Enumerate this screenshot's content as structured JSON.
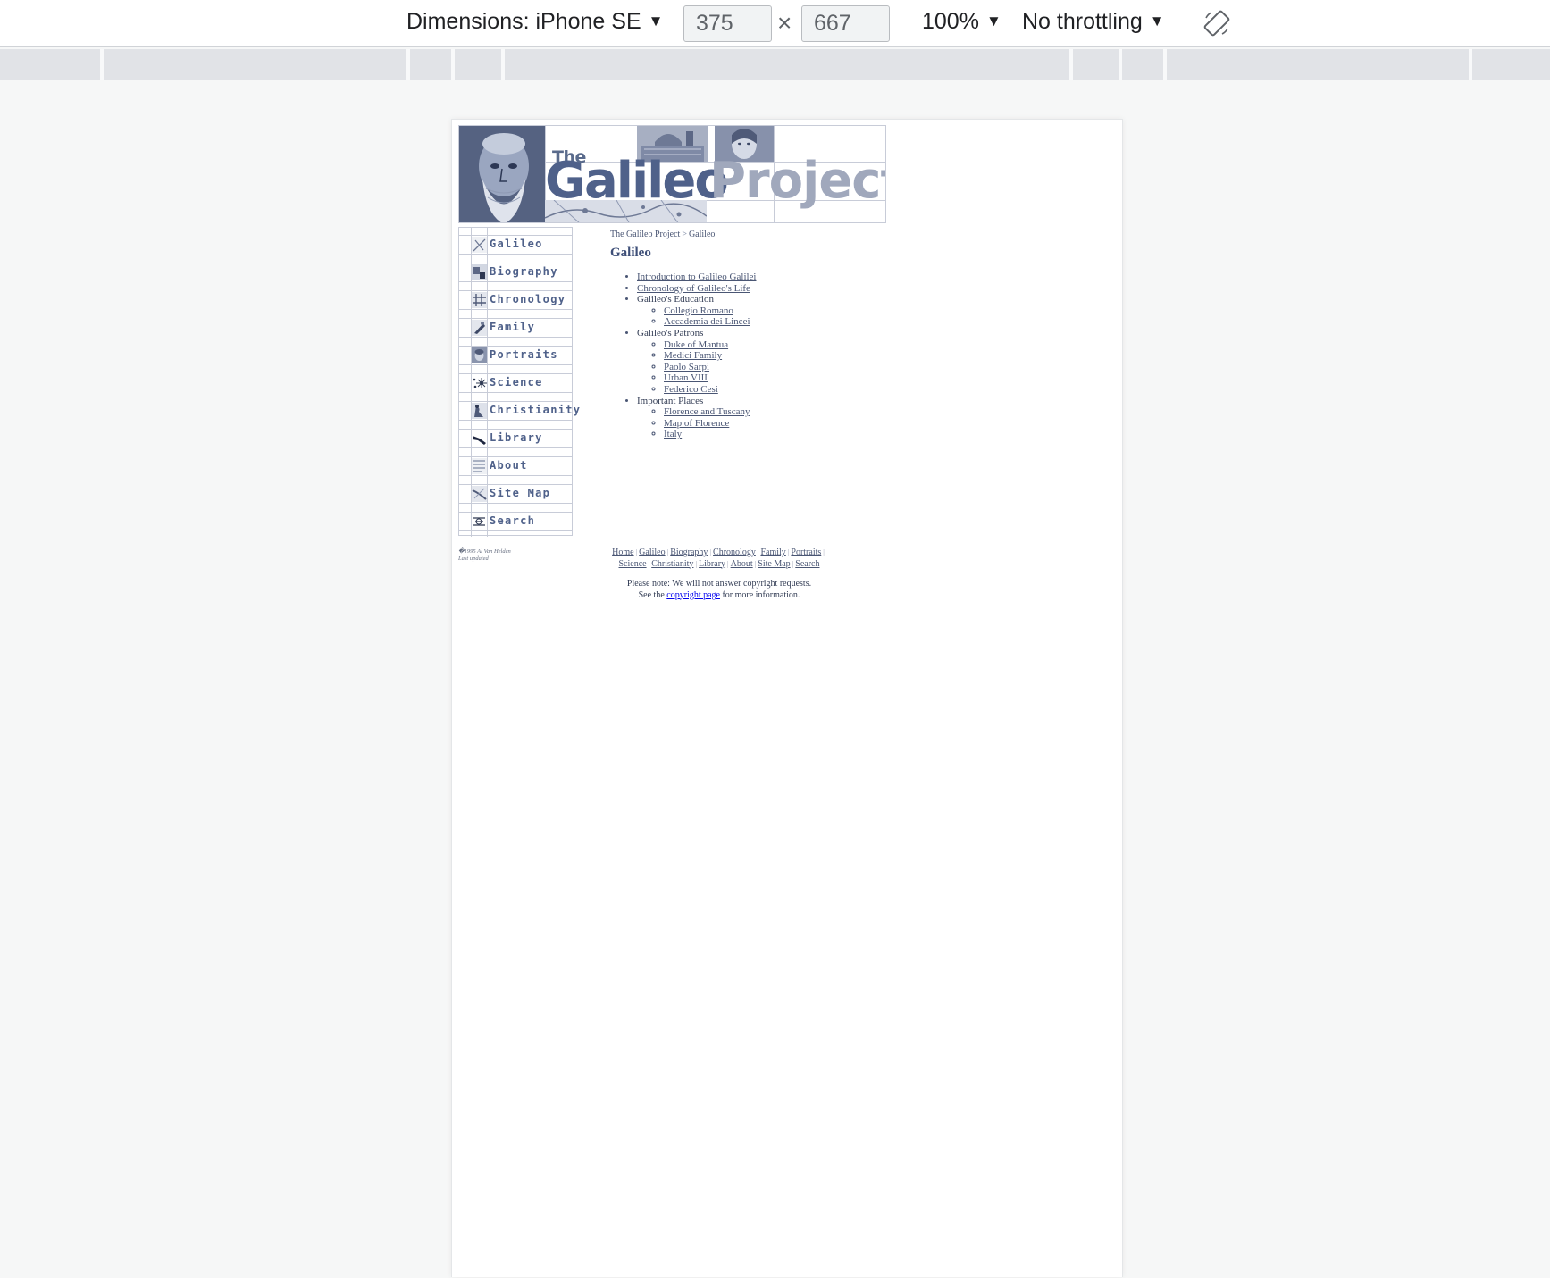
{
  "devtools": {
    "dimensions_label": "Dimensions: iPhone SE",
    "width_value": "375",
    "height_value": "667",
    "times_symbol": "×",
    "zoom_label": "100%",
    "throttling_label": "No throttling",
    "caret": "▼"
  },
  "banner": {
    "the": "The",
    "galileo": "Galileo",
    "project": "Project"
  },
  "nav": {
    "items": [
      {
        "label": "Galileo"
      },
      {
        "label": "Biography"
      },
      {
        "label": "Chronology"
      },
      {
        "label": "Family"
      },
      {
        "label": "Portraits"
      },
      {
        "label": "Science"
      },
      {
        "label": "Christianity"
      },
      {
        "label": "Library"
      },
      {
        "label": "About"
      },
      {
        "label": "Site Map"
      },
      {
        "label": "Search"
      }
    ]
  },
  "breadcrumb": {
    "home": "The Galileo Project",
    "separator": ">",
    "current": "Galileo"
  },
  "page_title": "Galileo",
  "content": {
    "intro": "Introduction to Galileo Galilei",
    "chronology": "Chronology of Galileo's Life",
    "education": {
      "label": "Galileo's Education",
      "items": [
        "Collegio Romano",
        "Accademia dei Lincei"
      ]
    },
    "patrons": {
      "label": "Galileo's Patrons",
      "items": [
        "Duke of Mantua",
        "Medici Family",
        "Paolo Sarpi",
        "Urban VIII",
        "Federico Cesi"
      ]
    },
    "places": {
      "label": "Important Places",
      "items": [
        "Florence and Tuscany",
        "Map of Florence",
        "Italy"
      ]
    }
  },
  "credit": {
    "line1": "�1995 Al Van Helden",
    "line2": "Last updated"
  },
  "footer": {
    "row1": [
      "Home",
      "Galileo",
      "Biography",
      "Chronology",
      "Family",
      "Portraits"
    ],
    "row2": [
      "Science",
      "Christianity",
      "Library",
      "About",
      "Site Map",
      "Search"
    ],
    "bar": "|"
  },
  "note": {
    "line1": "Please note: We will not answer copyright requests.",
    "line2_before": "See the",
    "line2_link": "copyright page",
    "line2_after": "for more information."
  },
  "colors": {
    "title_blue": "#4f618a",
    "project_gray": "#a0a8bc",
    "link": "#4a5674"
  }
}
